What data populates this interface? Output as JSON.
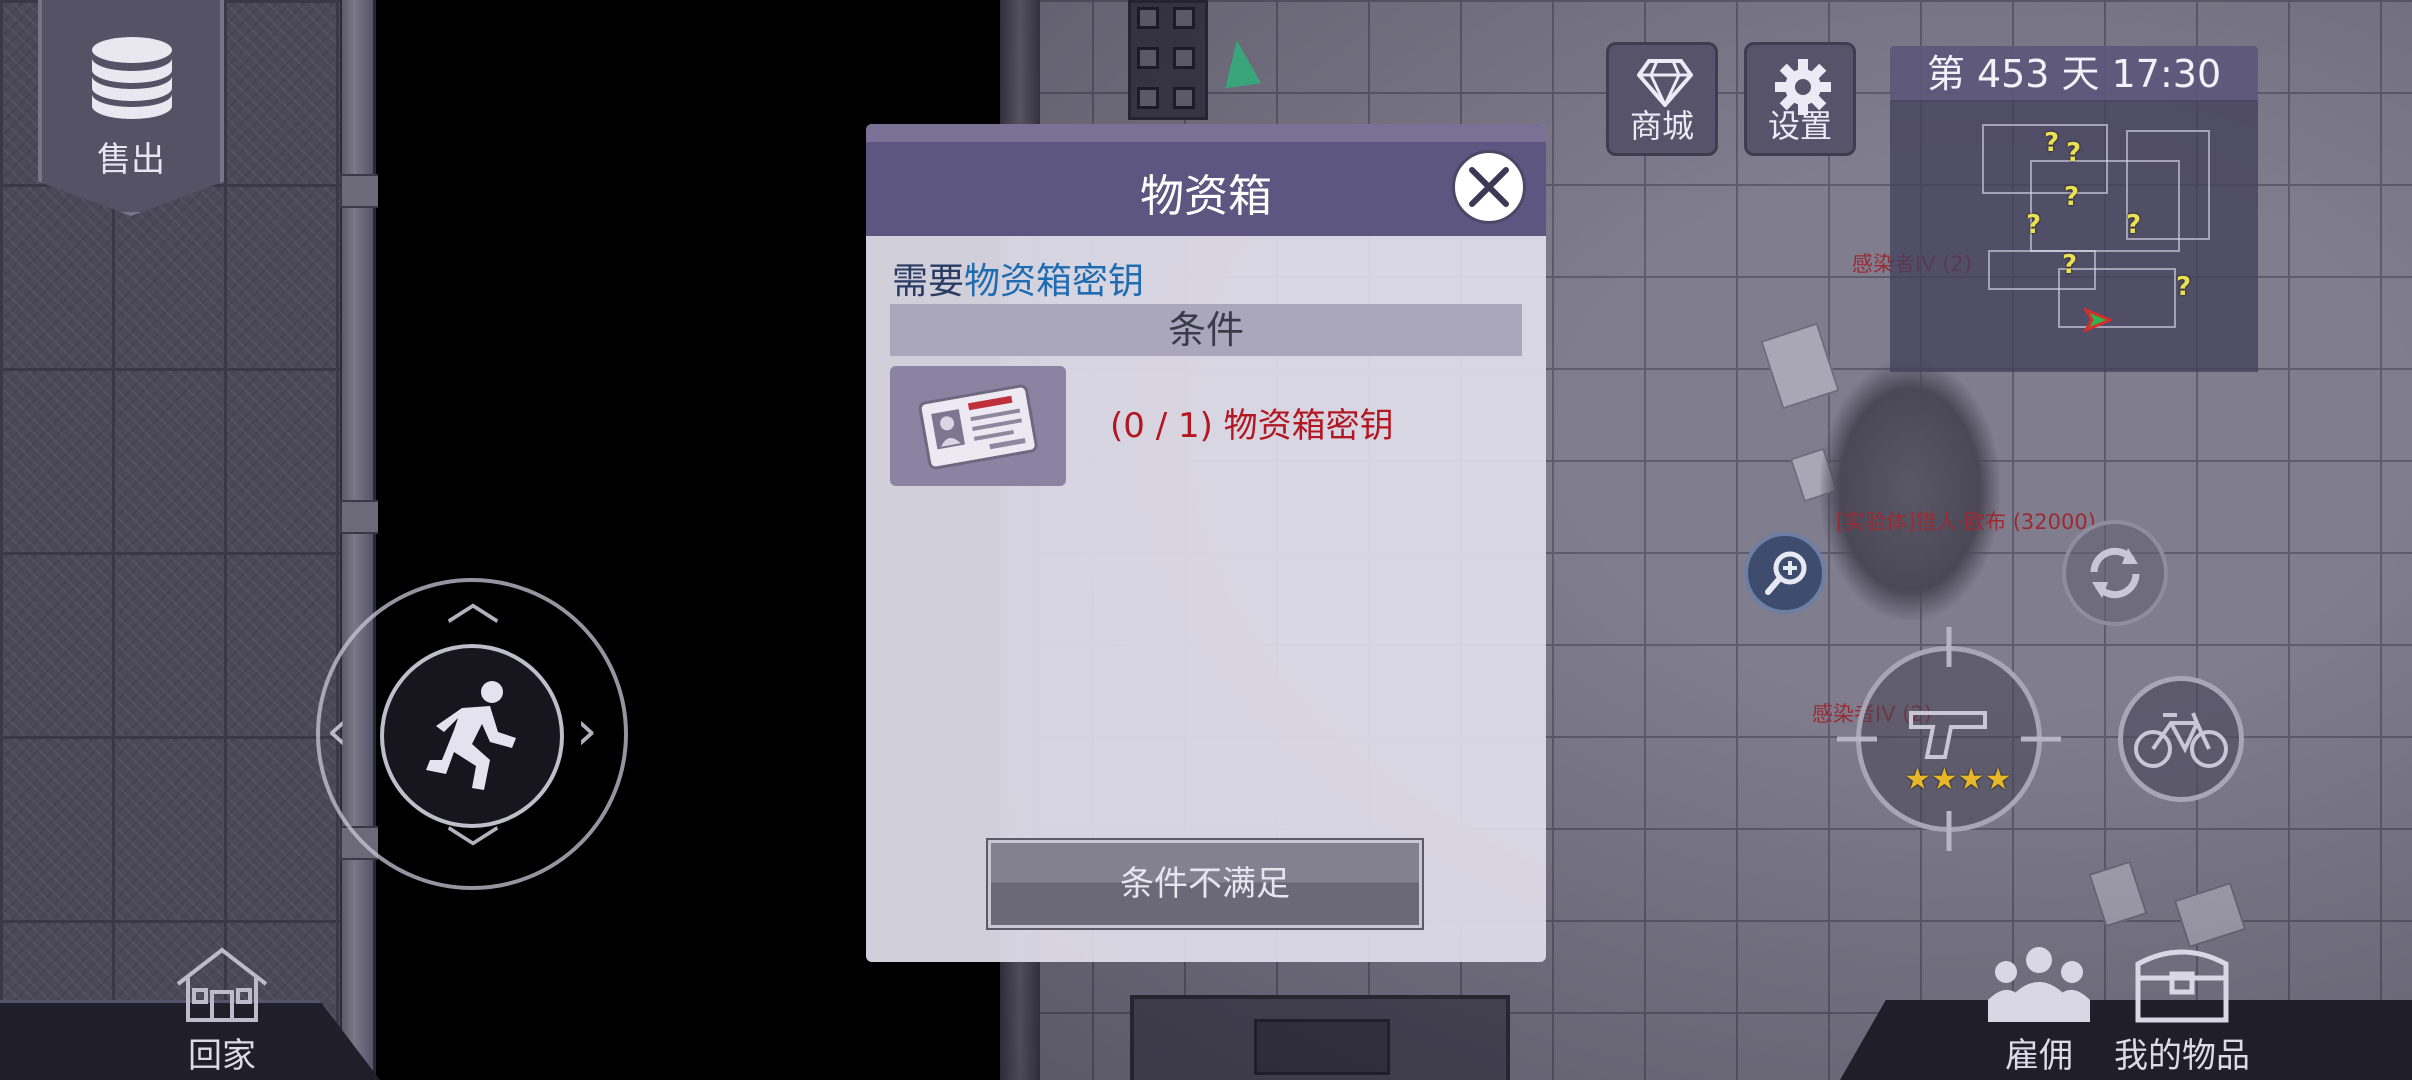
{
  "hud": {
    "sell_label": "售出",
    "shop_label": "商城",
    "settings_label": "设置",
    "day_time": "第 453 天  17:30",
    "home_label": "回家",
    "hire_label": "雇佣",
    "inventory_label": "我的物品",
    "weapon_stars": "★★★★"
  },
  "enemy_labels": {
    "infected_top": "感染者IV (2)",
    "experiment": "[实验体]猎人·欧布 (32000)",
    "infected_bottom": "感染者IV (2)"
  },
  "dialog": {
    "title": "物资箱",
    "requirement_prefix": "需要",
    "requirement_item": "物资箱密钥",
    "conditions_header": "条件",
    "condition_text": "(0 / 1) 物资箱密钥",
    "condition_progress": 0,
    "condition_total": 1,
    "unmet_button": "条件不满足"
  },
  "minimap_markers": [
    "?",
    "?",
    "?",
    "?",
    "?",
    "?",
    "?"
  ],
  "colors": {
    "dialog_header": "#5d5680",
    "requirement_highlight": "#1f6cb1",
    "condition_unmet": "#b21722",
    "star": "#e7b72a"
  },
  "icons": [
    "coins-icon",
    "diamond-icon",
    "gear-icon",
    "close-icon",
    "id-card-icon",
    "running-man-icon",
    "zoom-in-icon",
    "refresh-icon",
    "crosshair-icon",
    "pistol-icon",
    "bicycle-icon",
    "house-icon",
    "group-icon",
    "chest-icon",
    "nav-arrow-icon"
  ]
}
